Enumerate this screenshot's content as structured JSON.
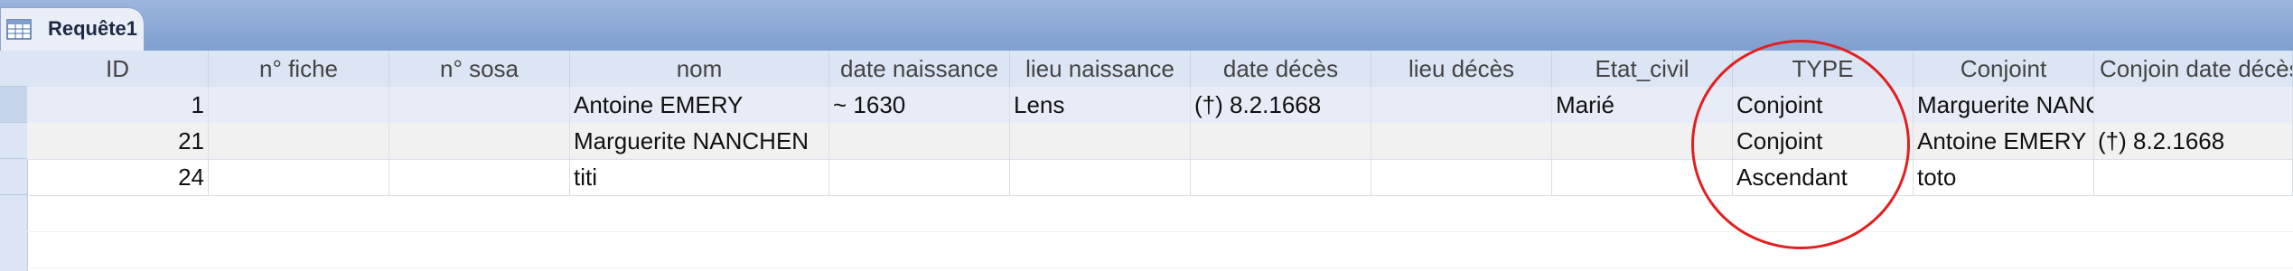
{
  "tab": {
    "label": "Requête1",
    "icon": "query-table-icon"
  },
  "columns": [
    "ID",
    "n° fiche",
    "n° sosa",
    "nom",
    "date naissance",
    "lieu naissance",
    "date décès",
    "lieu décès",
    "Etat_civil",
    "TYPE",
    "Conjoint",
    "Conjoin date décès"
  ],
  "rows": [
    [
      "1",
      "",
      "",
      "Antoine EMERY",
      "~ 1630",
      "Lens",
      "(†) 8.2.1668",
      "",
      "Marié",
      "Conjoint",
      "Marguerite NANCHEN",
      ""
    ],
    [
      "21",
      "",
      "",
      "Marguerite NANCHEN",
      "",
      "",
      "",
      "",
      "",
      "Conjoint",
      "Antoine EMERY",
      "(†) 8.2.1668"
    ],
    [
      "24",
      "",
      "",
      "titi",
      "",
      "",
      "",
      "",
      "",
      "Ascendant",
      "toto",
      ""
    ]
  ],
  "annotation": {
    "shape": "red-circle",
    "color": "#e02020"
  }
}
